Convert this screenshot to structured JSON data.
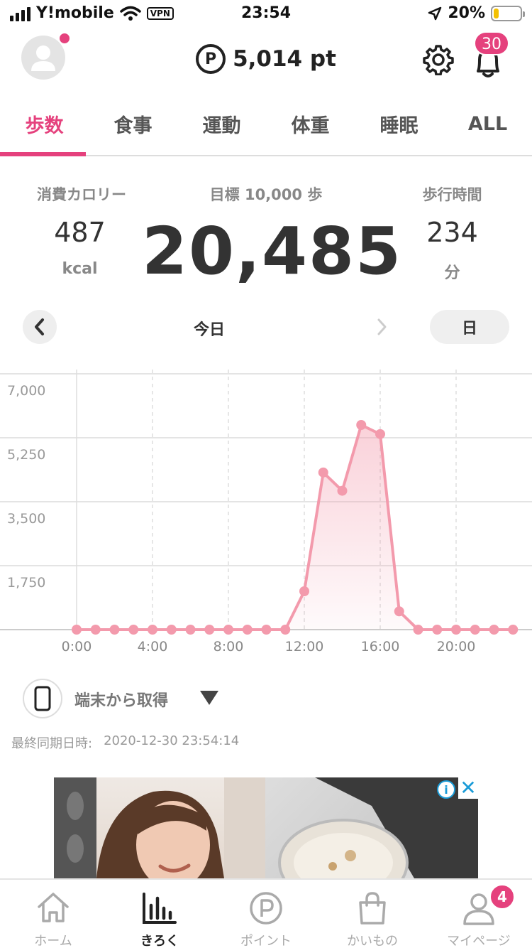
{
  "status_bar": {
    "carrier": "Y!mobile",
    "vpn": "VPN",
    "time": "23:54",
    "battery": "20%",
    "battery_level": 0.2
  },
  "header": {
    "points_symbol": "P",
    "points": "5,014 pt",
    "notification_count": "30"
  },
  "tabs": [
    {
      "label": "歩数",
      "active": true
    },
    {
      "label": "食事",
      "active": false
    },
    {
      "label": "運動",
      "active": false
    },
    {
      "label": "体重",
      "active": false
    },
    {
      "label": "睡眠",
      "active": false
    },
    {
      "label": "ALL",
      "active": false
    }
  ],
  "stats": {
    "calories_label": "消費カロリー",
    "calories_value": "487",
    "calories_unit": "kcal",
    "goal_label": "目標 10,000 歩",
    "steps": "20,485",
    "walk_time_label": "歩行時間",
    "walk_time_value": "234",
    "walk_time_unit": "分"
  },
  "date_nav": {
    "current": "今日",
    "period": "日"
  },
  "chart_data": {
    "type": "area",
    "x": [
      0,
      1,
      2,
      3,
      4,
      5,
      6,
      7,
      8,
      9,
      10,
      11,
      12,
      13,
      14,
      15,
      16,
      17,
      18,
      19,
      20,
      21,
      22,
      23
    ],
    "values": [
      0,
      0,
      0,
      0,
      0,
      0,
      0,
      0,
      0,
      0,
      0,
      0,
      1050,
      4300,
      3800,
      5600,
      5350,
      500,
      0,
      0,
      0,
      0,
      0,
      0
    ],
    "xticks": [
      "0:00",
      "4:00",
      "8:00",
      "12:00",
      "16:00",
      "20:00"
    ],
    "yticks": [
      "7,000",
      "5,250",
      "3,500",
      "1,750"
    ],
    "ylim": [
      0,
      7000
    ],
    "xlim": [
      0,
      24
    ],
    "grid": true,
    "color": "#f39aac"
  },
  "source": {
    "label": "端末から取得"
  },
  "sync": {
    "label": "最終同期日時:",
    "value": "2020-12-30 23:54:14"
  },
  "ad": {
    "info": "i",
    "close": "✕"
  },
  "bottom_nav": [
    {
      "label": "ホーム",
      "icon": "home-icon",
      "active": false
    },
    {
      "label": "きろく",
      "icon": "chart-icon",
      "active": true
    },
    {
      "label": "ポイント",
      "icon": "point-icon",
      "active": false
    },
    {
      "label": "かいもの",
      "icon": "shopping-bag-icon",
      "active": false
    },
    {
      "label": "マイページ",
      "icon": "user-icon",
      "active": false,
      "badge": "4"
    }
  ],
  "colors": {
    "accent": "#e5417d",
    "chart_line": "#f39aac",
    "info_blue": "#1a9bd7"
  }
}
